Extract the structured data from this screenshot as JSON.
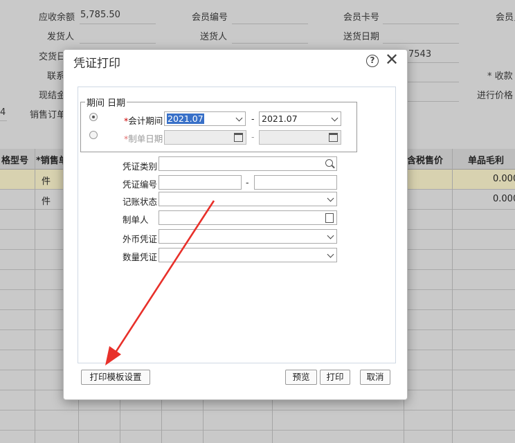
{
  "background": {
    "top_labels": [
      {
        "text": "应收余额",
        "value": "5,785.50"
      },
      {
        "text": "会员编号"
      },
      {
        "text": "会员卡号"
      },
      {
        "text": "会员员"
      },
      {
        "text": "发货人"
      },
      {
        "text": "送货人"
      },
      {
        "text": "送货日期"
      },
      {
        "text": "交货日"
      },
      {
        "text": "7543"
      },
      {
        "text": "联系"
      },
      {
        "text": "* 收款"
      },
      {
        "text": "现结金"
      },
      {
        "text": "进行价格"
      },
      {
        "text": "销售订单"
      },
      {
        "text": "4"
      }
    ],
    "grid_headers": {
      "col1": "格型号",
      "col2": "*销售单",
      "col3": "含税售价",
      "col4": "单品毛利"
    },
    "rows": [
      {
        "unit": "件",
        "margin": "0.000"
      },
      {
        "unit": "件",
        "margin": "0.000"
      }
    ]
  },
  "dialog": {
    "title": "凭证打印",
    "group_label": "期间 日期",
    "period_label": "会计期间",
    "period_from": "2021.07",
    "period_to": "2021.07",
    "range_sep": "-",
    "date_label": "制单日期",
    "fields": {
      "category": "凭证类别",
      "number": "凭证编号",
      "status": "记账状态",
      "maker": "制单人",
      "foreign": "外币凭证",
      "quantity": "数量凭证"
    },
    "buttons": {
      "template": "打印模板设置",
      "preview": "预览",
      "print": "打印",
      "cancel": "取消"
    }
  },
  "annotation_color": "#e8302a"
}
